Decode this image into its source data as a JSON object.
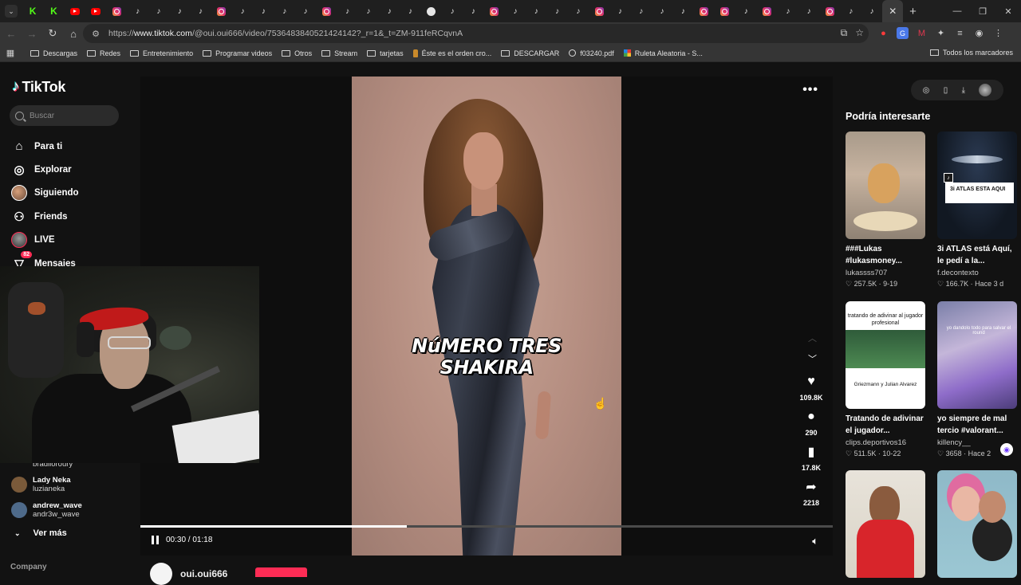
{
  "browser": {
    "tabs": [
      {
        "kind": "kick"
      },
      {
        "kind": "kick"
      },
      {
        "kind": "yt"
      },
      {
        "kind": "yt"
      },
      {
        "kind": "ig"
      },
      {
        "kind": "tt"
      },
      {
        "kind": "tt"
      },
      {
        "kind": "tt"
      },
      {
        "kind": "tt"
      },
      {
        "kind": "ig"
      },
      {
        "kind": "tt"
      },
      {
        "kind": "tt"
      },
      {
        "kind": "tt"
      },
      {
        "kind": "tt"
      },
      {
        "kind": "ig"
      },
      {
        "kind": "tt"
      },
      {
        "kind": "tt"
      },
      {
        "kind": "tt"
      },
      {
        "kind": "tt"
      },
      {
        "kind": "wa"
      },
      {
        "kind": "tt"
      },
      {
        "kind": "tt"
      },
      {
        "kind": "ig"
      },
      {
        "kind": "tt"
      },
      {
        "kind": "tt"
      },
      {
        "kind": "tt"
      },
      {
        "kind": "tt"
      },
      {
        "kind": "ig"
      },
      {
        "kind": "tt"
      },
      {
        "kind": "tt"
      },
      {
        "kind": "tt"
      },
      {
        "kind": "tt"
      },
      {
        "kind": "ig"
      },
      {
        "kind": "ig"
      },
      {
        "kind": "tt"
      },
      {
        "kind": "ig"
      },
      {
        "kind": "tt"
      },
      {
        "kind": "tt"
      },
      {
        "kind": "ig"
      },
      {
        "kind": "tt"
      },
      {
        "kind": "tt"
      },
      {
        "kind": "active"
      }
    ],
    "url_prefix": "https://",
    "url_host": "www.tiktok.com",
    "url_path": "/@oui.oui666/video/7536483840521424142?_r=1&_t=ZM-911feRCqvnA",
    "bookmarks": [
      {
        "label": "Descargas",
        "icon": "folder"
      },
      {
        "label": "Redes",
        "icon": "folder"
      },
      {
        "label": "Entretenimiento",
        "icon": "folder"
      },
      {
        "label": "Programar videos",
        "icon": "folder"
      },
      {
        "label": "Otros",
        "icon": "folder"
      },
      {
        "label": "Stream",
        "icon": "folder"
      },
      {
        "label": "tarjetas",
        "icon": "folder"
      },
      {
        "label": "Éste es el orden cro...",
        "icon": "bottle"
      },
      {
        "label": "DESCARGAR",
        "icon": "folder"
      },
      {
        "label": "f03240.pdf",
        "icon": "globe"
      },
      {
        "label": "Ruleta Aleatoria - S...",
        "icon": "color"
      }
    ],
    "all_bookmarks": "Todos los marcadores"
  },
  "sidebar": {
    "logo": "TikTok",
    "search_placeholder": "Buscar",
    "nav": [
      {
        "label": "Para ti",
        "icon": "home-icon"
      },
      {
        "label": "Explorar",
        "icon": "compass-icon"
      },
      {
        "label": "Siguiendo",
        "icon": "avatar"
      },
      {
        "label": "Friends",
        "icon": "friends-icon"
      },
      {
        "label": "LIVE",
        "icon": "live"
      },
      {
        "label": "Mensajes",
        "icon": "inbox-icon",
        "badge": "82"
      }
    ],
    "following_partial": "bradiloroury",
    "following": [
      {
        "name": "Lady Neka",
        "handle": "luzianeka",
        "color": "#7a5a3a"
      },
      {
        "name": "andrew_wave",
        "handle": "andr3w_wave",
        "color": "#4e6a8a"
      }
    ],
    "see_more": "Ver más",
    "company": "Company"
  },
  "player": {
    "caption_line1": "NúMERO TRES",
    "caption_line2": "SHAKIRA",
    "likes": "109.8K",
    "comments": "290",
    "saves": "17.8K",
    "shares": "2218",
    "time": "00:30 / 01:18",
    "progress_percent": 38.5,
    "author": "oui.oui666"
  },
  "recommendations": {
    "title": "Podría interesarte",
    "items": [
      {
        "thumb": "dog",
        "title": "###Lukas #lukasmoney...",
        "author": "lukassss707",
        "stats": "♡ 257.5K · 9-19"
      },
      {
        "thumb": "space",
        "thumb_text": "3i ATLAS ESTA AQUI",
        "title": "3i ATLAS está Aquí, le pedí a la...",
        "author": "f.decontexto",
        "stats": "♡ 166.7K · Hace 3 d"
      },
      {
        "thumb": "soccer",
        "thumb_text_top": "tratando de adivinar al jugador profesional",
        "thumb_text_bottom": "Griezmann y Julian Alvarez",
        "title": "Tratando de adivinar el jugador...",
        "author": "clips.deportivos16",
        "stats": "♡ 511.5K · 10-22"
      },
      {
        "thumb": "game",
        "thumb_text": "yo dandolo todo para salvar el round",
        "title": "yo siempre de mal tercio #valorant...",
        "author": "killency__",
        "stats": "♡ 3658 · Hace 2"
      },
      {
        "thumb": "man"
      },
      {
        "thumb": "couple"
      }
    ]
  }
}
